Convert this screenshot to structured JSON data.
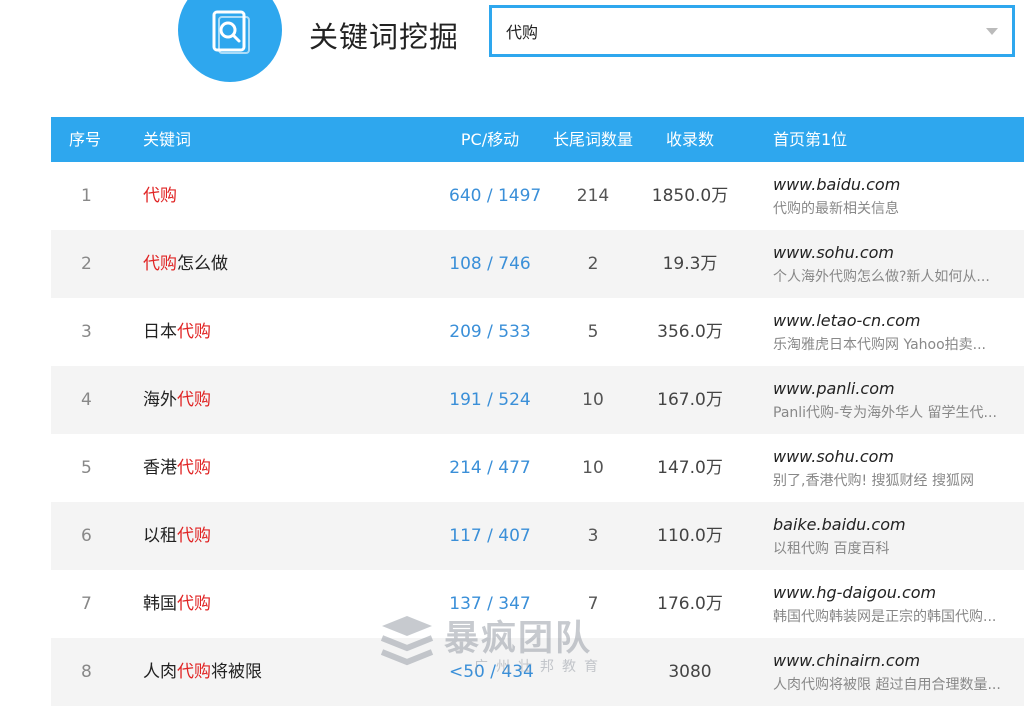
{
  "header": {
    "title": "关键词挖掘",
    "search_value": "代购",
    "accent_color": "#2ea7ee",
    "logo_icon": "search-document-icon"
  },
  "table": {
    "columns": [
      "序号",
      "关键词",
      "PC/移动",
      "长尾词数量",
      "收录数",
      "首页第1位"
    ],
    "rows": [
      {
        "idx": "1",
        "kw_pre": "",
        "kw_hl": "代购",
        "kw_post": "",
        "pc": "640 / 1497",
        "long": "214",
        "indexed": "1850.0万",
        "site": "www.baidu.com",
        "desc": "代购的最新相关信息"
      },
      {
        "idx": "2",
        "kw_pre": "",
        "kw_hl": "代购",
        "kw_post": "怎么做",
        "pc": "108 / 746",
        "long": "2",
        "indexed": "19.3万",
        "site": "www.sohu.com",
        "desc": "个人海外代购怎么做?新人如何从..."
      },
      {
        "idx": "3",
        "kw_pre": "日本",
        "kw_hl": "代购",
        "kw_post": "",
        "pc": "209 / 533",
        "long": "5",
        "indexed": "356.0万",
        "site": "www.letao-cn.com",
        "desc": "乐淘雅虎日本代购网 Yahoo拍卖..."
      },
      {
        "idx": "4",
        "kw_pre": "海外",
        "kw_hl": "代购",
        "kw_post": "",
        "pc": "191 / 524",
        "long": "10",
        "indexed": "167.0万",
        "site": "www.panli.com",
        "desc": "Panli代购-专为海外华人 留学生代..."
      },
      {
        "idx": "5",
        "kw_pre": "香港",
        "kw_hl": "代购",
        "kw_post": "",
        "pc": "214 / 477",
        "long": "10",
        "indexed": "147.0万",
        "site": "www.sohu.com",
        "desc": "别了,香港代购! 搜狐财经 搜狐网"
      },
      {
        "idx": "6",
        "kw_pre": "以租",
        "kw_hl": "代购",
        "kw_post": "",
        "pc": "117 / 407",
        "long": "3",
        "indexed": "110.0万",
        "site": "baike.baidu.com",
        "desc": "以租代购 百度百科"
      },
      {
        "idx": "7",
        "kw_pre": "韩国",
        "kw_hl": "代购",
        "kw_post": "",
        "pc": "137 / 347",
        "long": "7",
        "indexed": "176.0万",
        "site": "www.hg-daigou.com",
        "desc": "韩国代购韩装网是正宗的韩国代购..."
      },
      {
        "idx": "8",
        "kw_pre": "人肉",
        "kw_hl": "代购",
        "kw_post": "将被限",
        "pc": "<50 / 434",
        "long": "",
        "indexed": "3080",
        "site": "www.chinairn.com",
        "desc": "人肉代购将被限 超过自用合理数量..."
      }
    ]
  },
  "watermark": {
    "title": "暴疯团队",
    "subtitle": "广州壮邦教育"
  }
}
